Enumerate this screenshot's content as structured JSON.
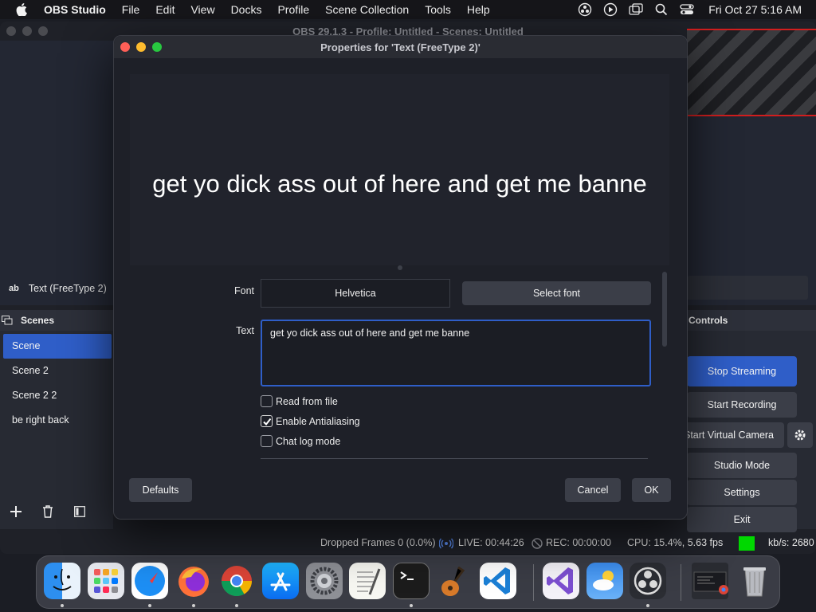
{
  "menubar": {
    "apple_icon": "apple-logo-icon",
    "app_name": "OBS Studio",
    "items": [
      "File",
      "Edit",
      "View",
      "Docks",
      "Profile",
      "Scene Collection",
      "Tools",
      "Help"
    ],
    "clock": "Fri Oct 27  5:16 AM"
  },
  "obs": {
    "window_title": "OBS 29.1.3 - Profile: Untitled - Scenes: Untitled",
    "source_icon_label": "ab",
    "source_name": "Text (FreeType 2)",
    "scenes_header": "Scenes",
    "scenes": [
      "Scene",
      "Scene 2",
      "Scene 2 2",
      "be right back"
    ],
    "controls_header": "Controls",
    "controls": {
      "stop_streaming": "Stop Streaming",
      "start_recording": "Start Recording",
      "start_virtual_camera": "Start Virtual Camera",
      "studio_mode": "Studio Mode",
      "settings": "Settings",
      "exit": "Exit"
    },
    "status": {
      "dropped_frames": "Dropped Frames 0 (0.0%)",
      "live": "LIVE: 00:44:26",
      "rec": "REC: 00:00:00",
      "cpu": "CPU: 15.4%, 5.63 fps",
      "kbs": "kb/s: 2680"
    }
  },
  "dialog": {
    "title": "Properties for 'Text (FreeType 2)'",
    "preview_text": "get yo dick ass out of here and get me banne",
    "font_label": "Font",
    "font_value": "Helvetica",
    "select_font": "Select font",
    "text_label": "Text",
    "text_value": "get yo dick ass out of here and get me banne",
    "checkboxes": [
      {
        "label": "Read from file",
        "checked": false
      },
      {
        "label": "Enable Antialiasing",
        "checked": true
      },
      {
        "label": "Chat log mode",
        "checked": false
      }
    ],
    "defaults": "Defaults",
    "cancel": "Cancel",
    "ok": "OK"
  },
  "colors": {
    "accent": "#2f5ec8",
    "stream_indicator": "#00d800",
    "preview_border": "#d21e1e"
  },
  "dock": {
    "apps": [
      "finder-icon",
      "launchpad-icon",
      "safari-icon",
      "firefox-icon",
      "chrome-icon",
      "app-store-icon",
      "system-settings-icon",
      "textedit-icon",
      "terminal-icon",
      "garageband-icon",
      "vscode-icon",
      "visual-studio-icon",
      "weather-icon",
      "obs-icon",
      "screenshot-thumbnail-icon",
      "trash-icon"
    ]
  }
}
